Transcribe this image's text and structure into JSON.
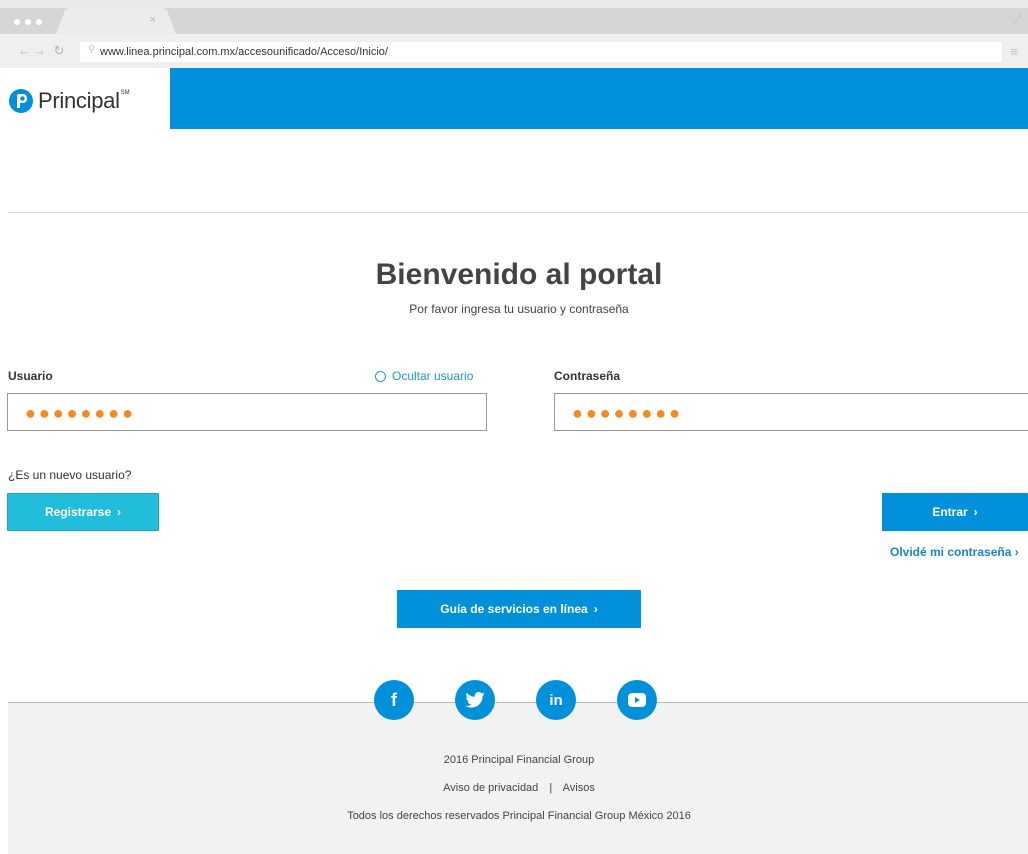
{
  "browser": {
    "tab_close": "×",
    "url": "www.linea.principal.com.mx/accesounificado/Acceso/Inicio/"
  },
  "header": {
    "logo_text": "Principal",
    "logo_mark": "SM",
    "band_color": "#0091da"
  },
  "welcome": {
    "title": "Bienvenido al portal",
    "subtitle": "Por favor ingresa tu usuario y contraseña"
  },
  "form": {
    "user_label": "Usuario",
    "hide_user_label": "Ocultar usuario",
    "user_value": "●●●●●●●●",
    "password_label": "Contraseña",
    "password_value": "●●●●●●●●",
    "new_user_text": "¿Es un nuevo usuario?",
    "register_label": "Registrarse",
    "enter_label": "Entrar",
    "forgot_label": "Olvidé mi contraseña",
    "guide_label": "Guía de servicios en línea"
  },
  "social": {
    "facebook": "f",
    "twitter": "twitter-bird",
    "linkedin": "in",
    "youtube": "youtube-play"
  },
  "footer": {
    "copyright": "2016 Principal Financial Group",
    "privacy": "Aviso de privacidad",
    "separator": "|",
    "notices": "Avisos",
    "rights": "Todos los derechos reservados Principal Financial Group México 2016"
  },
  "colors": {
    "primary": "#0091da",
    "accent_register": "#21bddb",
    "password_dots": "#f6891f"
  }
}
